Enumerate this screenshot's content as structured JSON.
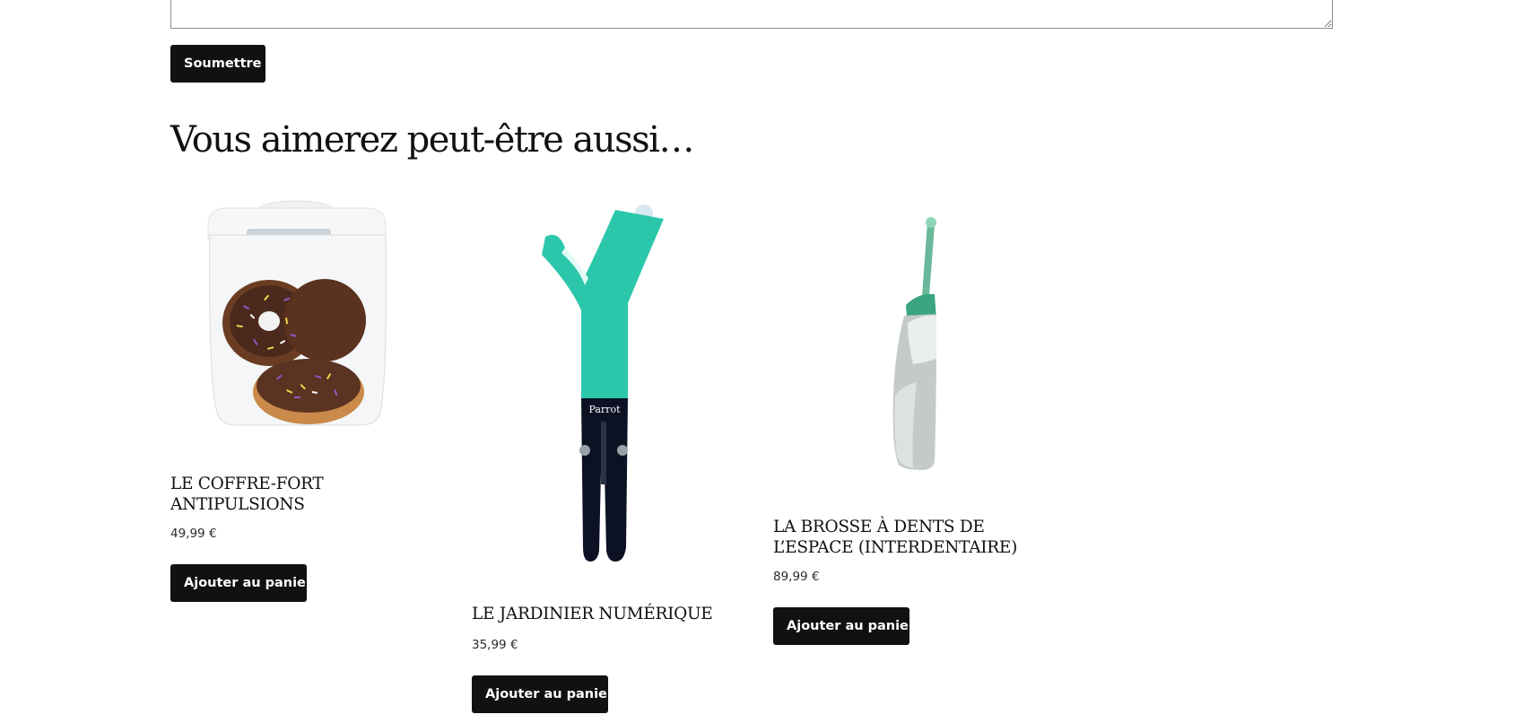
{
  "review_form": {
    "submit_label": "Soumettre"
  },
  "related": {
    "title": "Vous aimerez peut-être aussi…",
    "products": [
      {
        "name": "LE COFFRE-FORT ANTIPULSIONS",
        "price": "49,99 €",
        "button_label": "Ajouter au panier",
        "image": "timelock-jar-with-donuts"
      },
      {
        "name": "LE JARDINIER NUMÉRIQUE",
        "price": "35,99 €",
        "button_label": "Ajouter au panier",
        "image": "parrot-plant-sensor",
        "image_text": "Parrot"
      },
      {
        "name": "LA BROSSE À DENTS DE L’ESPACE (INTERDENTAIRE)",
        "price": "89,99 €",
        "button_label": "Ajouter au panier",
        "image": "interdental-water-flosser"
      }
    ]
  },
  "colors": {
    "button_bg": "#111111",
    "button_text": "#ffffff",
    "sensor_teal": "#2cc7ab",
    "sensor_dark": "#0c1224"
  }
}
